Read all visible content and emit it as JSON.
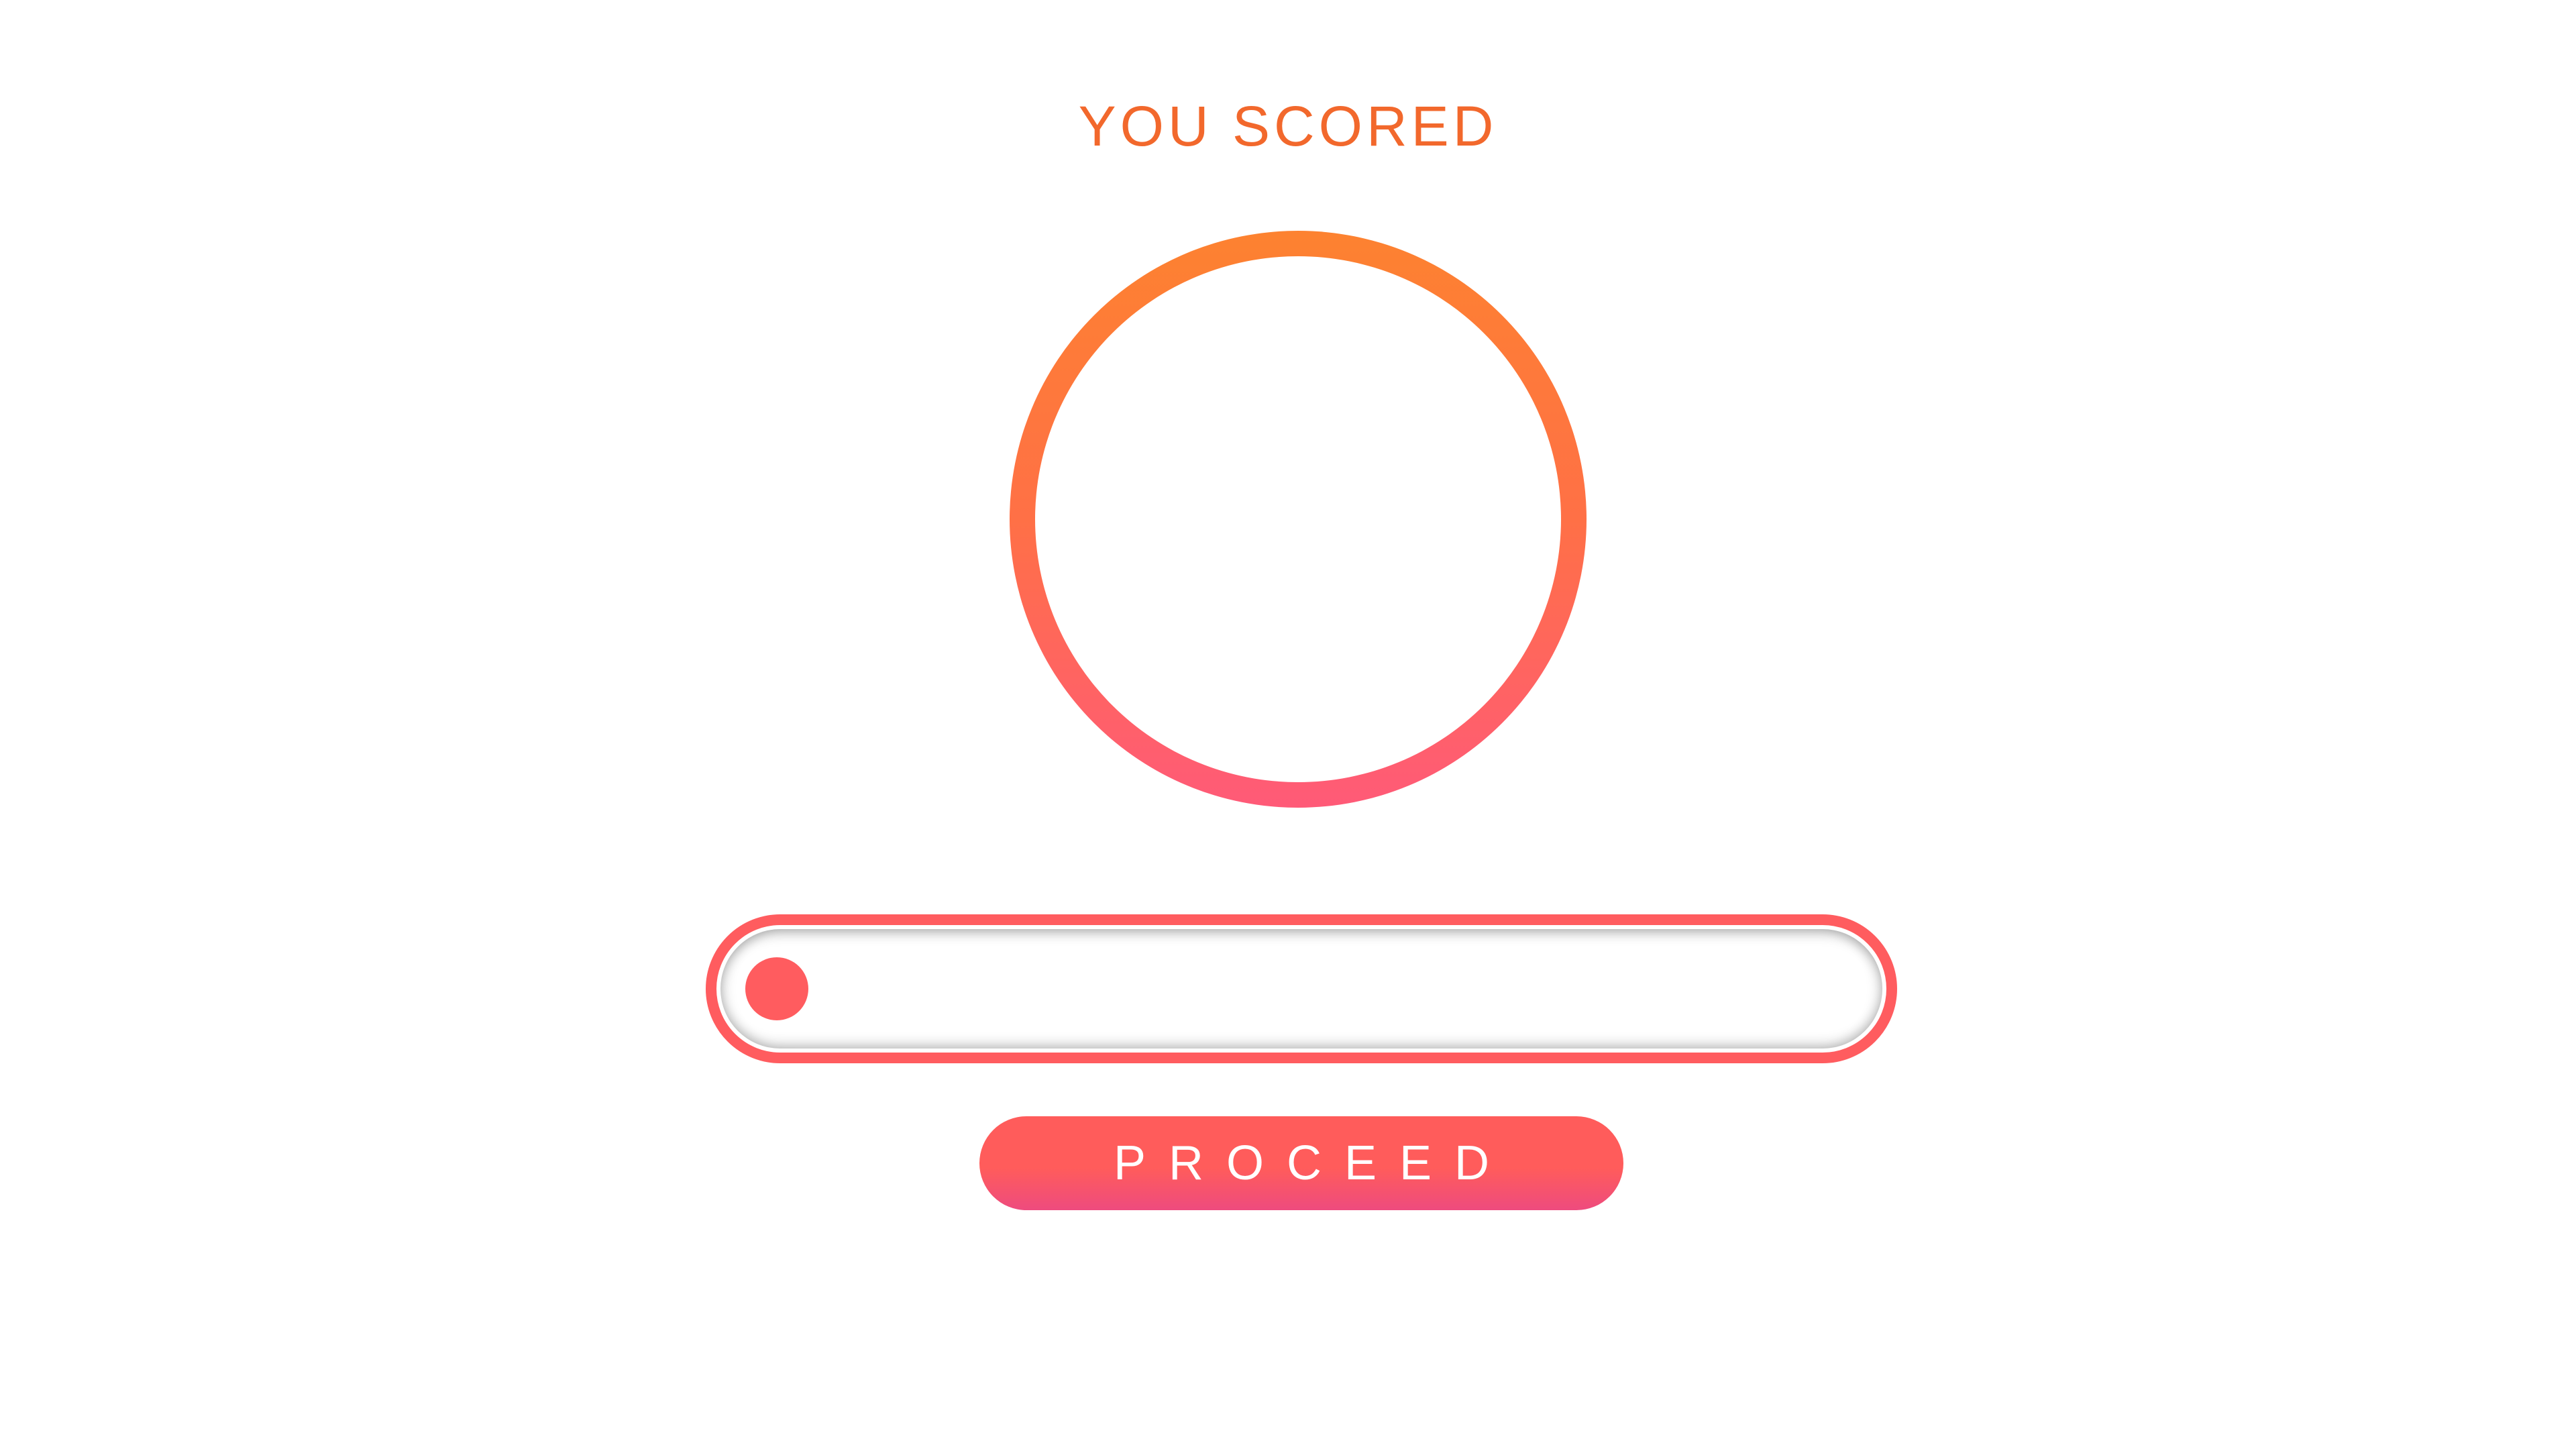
{
  "score_screen": {
    "title": "YOU SCORED",
    "score_value": "",
    "colors": {
      "title": "#f2682c",
      "ring_top": "#fd8230",
      "ring_bottom": "#ff5a78",
      "slider": "#ff5c5f",
      "button_top": "#ff5c5b",
      "button_bottom": "#ee4b7e"
    }
  },
  "slider": {
    "level": 0
  },
  "actions": {
    "proceed_label": "PROCEED"
  }
}
